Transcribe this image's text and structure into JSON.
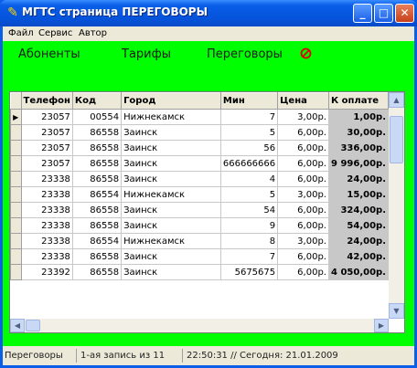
{
  "window": {
    "title": "МГТС страница ПЕРЕГОВОРЫ",
    "app_icon": "app-icon",
    "controls": {
      "minimize": "_",
      "maximize": "□",
      "close": "✕"
    }
  },
  "menu": {
    "items": [
      "Файл",
      "Сервис",
      "Автор"
    ]
  },
  "nav": {
    "links": [
      "Абоненты",
      "Тарифы",
      "Переговоры"
    ],
    "stop_icon": "stop-icon"
  },
  "table": {
    "columns": [
      "Телефон",
      "Код",
      "Город",
      "Мин",
      "Цена",
      "К оплате"
    ],
    "rows": [
      {
        "phone": "23057",
        "code": "00554",
        "city": "Нижнекамск",
        "min": "7",
        "price": "3,00р.",
        "total": "1,00р."
      },
      {
        "phone": "23057",
        "code": "86558",
        "city": "Заинск",
        "min": "5",
        "price": "6,00р.",
        "total": "30,00р."
      },
      {
        "phone": "23057",
        "code": "86558",
        "city": "Заинск",
        "min": "56",
        "price": "6,00р.",
        "total": "336,00р."
      },
      {
        "phone": "23057",
        "code": "86558",
        "city": "Заинск",
        "min": "666666666",
        "price": "6,00р.",
        "total": "9 996,00р."
      },
      {
        "phone": "23338",
        "code": "86558",
        "city": "Заинск",
        "min": "4",
        "price": "6,00р.",
        "total": "24,00р."
      },
      {
        "phone": "23338",
        "code": "86554",
        "city": "Нижнекамск",
        "min": "5",
        "price": "3,00р.",
        "total": "15,00р."
      },
      {
        "phone": "23338",
        "code": "86558",
        "city": "Заинск",
        "min": "54",
        "price": "6,00р.",
        "total": "324,00р."
      },
      {
        "phone": "23338",
        "code": "86558",
        "city": "Заинск",
        "min": "9",
        "price": "6,00р.",
        "total": "54,00р."
      },
      {
        "phone": "23338",
        "code": "86554",
        "city": "Нижнекамск",
        "min": "8",
        "price": "3,00р.",
        "total": "24,00р."
      },
      {
        "phone": "23338",
        "code": "86558",
        "city": "Заинск",
        "min": "7",
        "price": "6,00р.",
        "total": "42,00р."
      },
      {
        "phone": "23392",
        "code": "86558",
        "city": "Заинск",
        "min": "5675675",
        "price": "6,00р.",
        "total": "4 050,00р."
      }
    ]
  },
  "status": {
    "panel1": "Переговоры",
    "panel2": "1-ая запись из 11",
    "panel3": "22:50:31  // Сегодня: 21.01.2009"
  },
  "colors": {
    "client_bg": "#00ff00",
    "total_bg": "#c8c8c8",
    "stop": "#e00000"
  }
}
